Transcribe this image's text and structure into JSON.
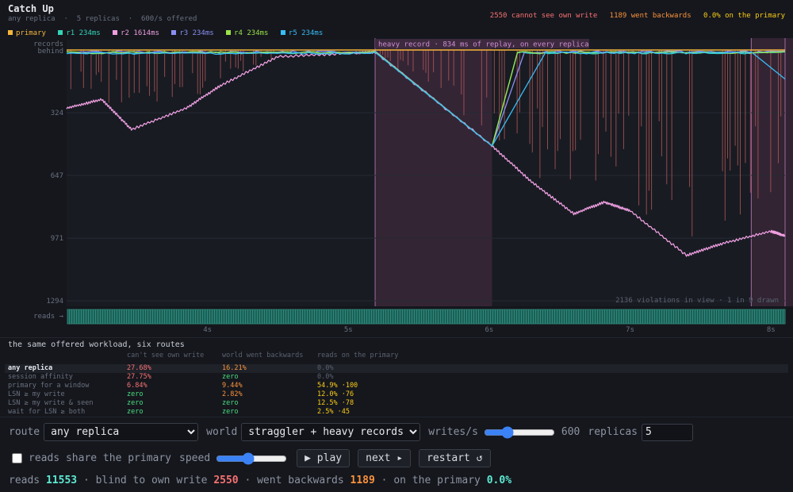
{
  "header": {
    "title": "Catch Up",
    "subtitle": "any replica  ·  5 replicas  ·  600/s offered",
    "summary": [
      {
        "text": "2550 cannot see own write",
        "color": "#f87171"
      },
      {
        "text": "1189 went backwards",
        "color": "#fb923c"
      },
      {
        "text": "0.0% on the primary",
        "color": "#facc15"
      }
    ]
  },
  "legend": [
    {
      "label": "primary",
      "color": "#f5b63a"
    },
    {
      "label": "r1 234ms",
      "color": "#34d3b8"
    },
    {
      "label": "r2 1614ms",
      "color": "#ee9ee0"
    },
    {
      "label": "r3 234ms",
      "color": "#8b8ff3"
    },
    {
      "label": "r4 234ms",
      "color": "#9be34a"
    },
    {
      "label": "r5 234ms",
      "color": "#38bdf8"
    }
  ],
  "chart_data": {
    "type": "line",
    "ylabel": "records behind",
    "y_ticks": [
      "324",
      "647",
      "971",
      "1294"
    ],
    "ylim": [
      0,
      1294
    ],
    "x_ticks": [
      "4s",
      "5s",
      "6s",
      "7s",
      "8s"
    ],
    "xlim": [
      3.0,
      8.1
    ],
    "heavy_band": {
      "start": 5.19,
      "end": 6.02,
      "label": "heavy record · 834 ms of replay, on every replica"
    },
    "tail_band": {
      "start": 7.86,
      "end": 8.1
    },
    "violations_label": "2136 violations in view · 1 in 9 drawn",
    "reads_label": "reads →",
    "series": [
      {
        "name": "primary",
        "color": "#f5b63a",
        "x": [
          3.0,
          8.1
        ],
        "y": [
          0,
          0
        ]
      },
      {
        "name": "r1",
        "color": "#34d3b8",
        "x": [
          3.0,
          5.19,
          6.02,
          6.2,
          8.1
        ],
        "y": [
          10,
          10,
          495,
          10,
          10
        ]
      },
      {
        "name": "r2",
        "color": "#ee9ee0",
        "x": [
          3.0,
          3.25,
          3.46,
          3.85,
          4.1,
          4.5,
          5.05,
          5.19,
          6.02,
          6.3,
          6.6,
          6.82,
          7.0,
          7.4,
          7.65,
          8.0,
          8.1
        ],
        "y": [
          300,
          255,
          410,
          300,
          180,
          35,
          15,
          10,
          495,
          680,
          845,
          785,
          830,
          1060,
          1000,
          935,
          960
        ]
      },
      {
        "name": "r3",
        "color": "#8b8ff3",
        "x": [
          3.0,
          5.19,
          6.02,
          6.25,
          8.1
        ],
        "y": [
          5,
          5,
          495,
          5,
          5
        ]
      },
      {
        "name": "r4",
        "color": "#9be34a",
        "x": [
          3.0,
          5.19,
          6.02,
          6.2,
          8.1
        ],
        "y": [
          8,
          8,
          495,
          8,
          8
        ]
      },
      {
        "name": "r5",
        "color": "#38bdf8",
        "x": [
          3.0,
          5.19,
          6.02,
          6.4,
          7.86,
          8.1
        ],
        "y": [
          12,
          12,
          495,
          10,
          10,
          150
        ]
      }
    ]
  },
  "table": {
    "title": "the same offered workload, six routes",
    "headers": [
      "can't see own write",
      "world went backwards",
      "reads on the primary"
    ],
    "rows": [
      {
        "label": "any replica",
        "own": "27.68%",
        "back": "16.21%",
        "primary": "0.0%",
        "own_color": "#f87171",
        "back_color": "#fb923c",
        "primary_color": "#5b616e"
      },
      {
        "label": "session affinity",
        "own": "27.75%",
        "back": "zero",
        "primary": "0.0%",
        "own_color": "#f87171",
        "back_color": "#4ade80",
        "primary_color": "#5b616e"
      },
      {
        "label": "primary for a window",
        "own": "6.84%",
        "back": "9.44%",
        "primary": "54.9% ·100",
        "own_color": "#f87171",
        "back_color": "#fb923c",
        "primary_color": "#facc15"
      },
      {
        "label": "LSN ≥ my write",
        "own": "zero",
        "back": "2.82%",
        "primary": "12.0% ·76",
        "own_color": "#4ade80",
        "back_color": "#fb923c",
        "primary_color": "#facc15"
      },
      {
        "label": "LSN ≥ my write & seen",
        "own": "zero",
        "back": "zero",
        "primary": "12.5% ·78",
        "own_color": "#4ade80",
        "back_color": "#4ade80",
        "primary_color": "#facc15"
      },
      {
        "label": "wait for LSN ≥ both",
        "own": "zero",
        "back": "zero",
        "primary": "2.5% ·45",
        "own_color": "#4ade80",
        "back_color": "#4ade80",
        "primary_color": "#facc15"
      }
    ]
  },
  "controls": {
    "route_label": "route",
    "route_value": "any replica",
    "world_label": "world",
    "world_value": "straggler + heavy records",
    "writes_label": "writes/s",
    "writes_value": "600",
    "writes_fraction": 0.3,
    "replicas_label": "replicas",
    "replicas_value": "5",
    "share_label": "reads share the primary",
    "share_checked": false,
    "speed_label": "speed",
    "speed_fraction": 0.45,
    "play_label": "▶ play",
    "next_label": "next ▸",
    "restart_label": "restart ↺"
  },
  "status": {
    "reads_label": "reads",
    "reads_value": "11553",
    "blind_label": "blind to own write",
    "blind_value": "2550",
    "back_label": "went backwards",
    "back_value": "1189",
    "primary_label": "on the primary",
    "primary_value": "0.0%",
    "sep": "·"
  }
}
